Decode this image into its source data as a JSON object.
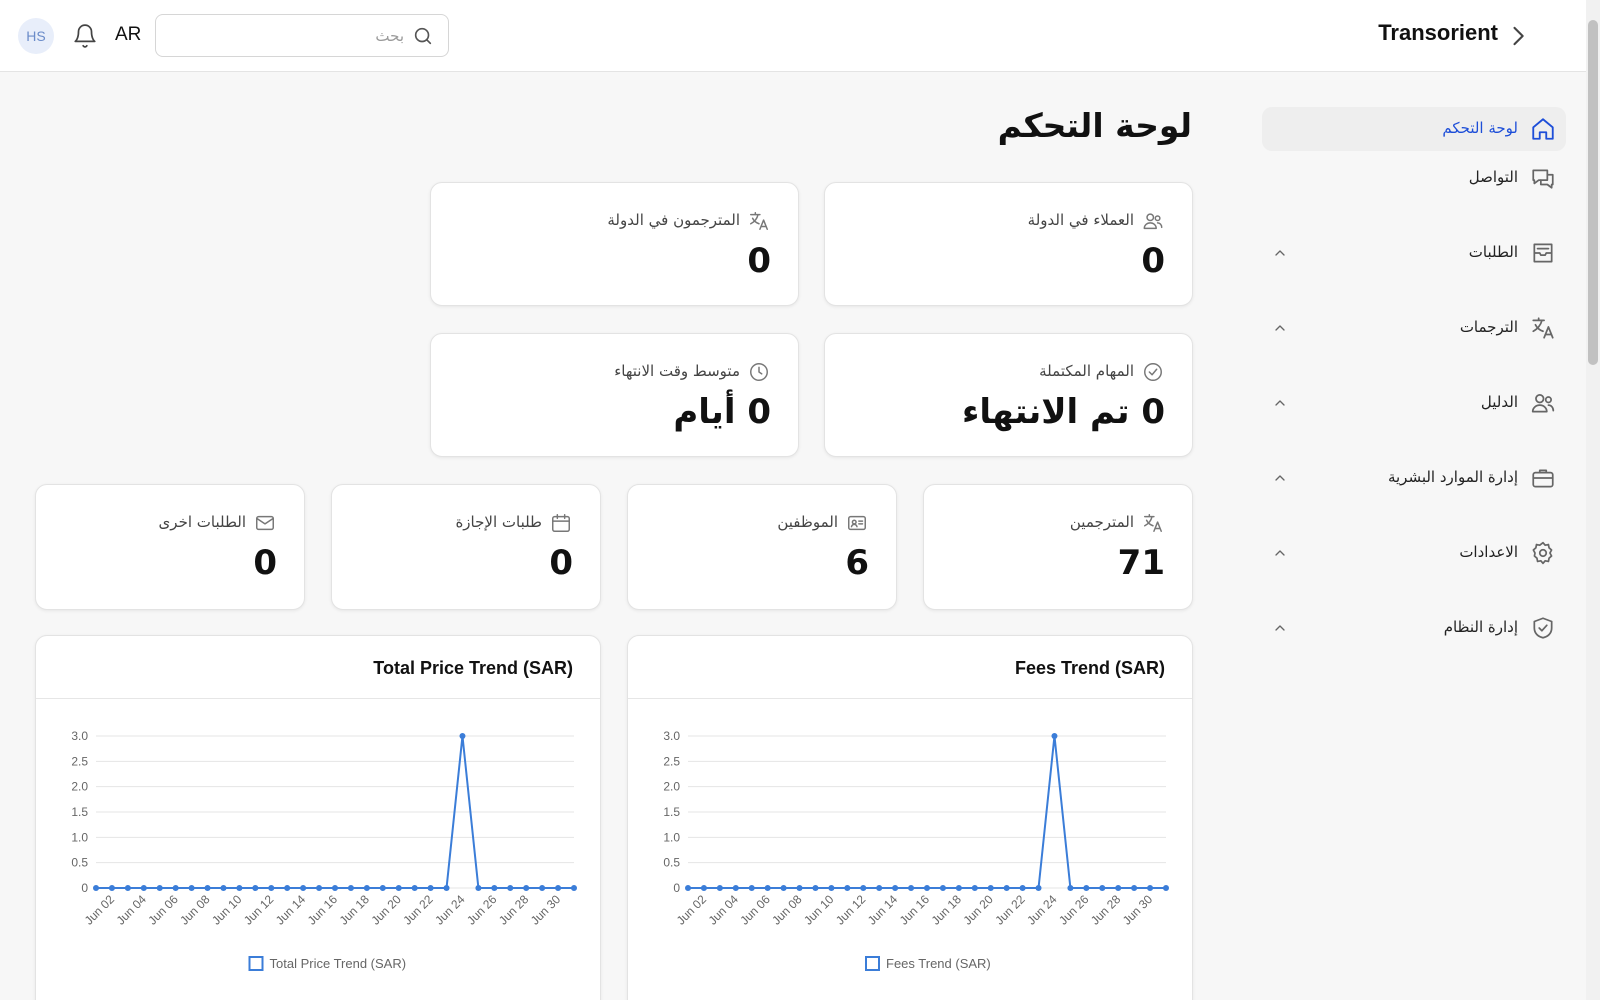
{
  "header": {
    "avatar_initials": "HS",
    "language": "AR",
    "search_placeholder": "بحث",
    "search_value": "",
    "brand": "Transorient"
  },
  "sidebar": {
    "items": [
      {
        "label": "لوحة التحكم",
        "icon": "home-icon",
        "active": true,
        "expandable": false
      },
      {
        "label": "التواصل",
        "icon": "chat-icon",
        "active": false,
        "expandable": false
      },
      {
        "label": "الطلبات",
        "icon": "inbox-icon",
        "active": false,
        "expandable": true
      },
      {
        "label": "الترجمات",
        "icon": "translate-icon",
        "active": false,
        "expandable": true
      },
      {
        "label": "الدليل",
        "icon": "users-icon",
        "active": false,
        "expandable": true
      },
      {
        "label": "إدارة الموارد البشرية",
        "icon": "briefcase-icon",
        "active": false,
        "expandable": true
      },
      {
        "label": "الاعدادات",
        "icon": "gear-icon",
        "active": false,
        "expandable": true
      },
      {
        "label": "إدارة النظام",
        "icon": "shield-check-icon",
        "active": false,
        "expandable": true
      }
    ]
  },
  "main": {
    "title": "لوحة التحكم",
    "stats_top": [
      {
        "label": "العملاء في الدولة",
        "value": "0",
        "icon": "users-icon"
      },
      {
        "label": "المترجمون في الدولة",
        "value": "0",
        "icon": "translate-icon"
      },
      {
        "label": "المهام المكتملة",
        "value": "0 تم الانتهاء",
        "icon": "check-circle-icon"
      },
      {
        "label": "متوسط وقت الانتهاء",
        "value": "0 أيام",
        "icon": "clock-icon"
      }
    ],
    "stats_bottom": [
      {
        "label": "المترجمين",
        "value": "71",
        "icon": "translate-icon"
      },
      {
        "label": "الموظفين",
        "value": "6",
        "icon": "id-card-icon"
      },
      {
        "label": "طلبات الإجازة",
        "value": "0",
        "icon": "calendar-icon"
      },
      {
        "label": "الطلبات اخرى",
        "value": "0",
        "icon": "mail-icon"
      }
    ]
  },
  "colors": {
    "accent": "#1d4ed8",
    "series": "#3b7dd8"
  },
  "chart_data": [
    {
      "type": "line",
      "title": "Fees Trend (SAR)",
      "x": [
        "Jun 01",
        "Jun 02",
        "Jun 03",
        "Jun 04",
        "Jun 05",
        "Jun 06",
        "Jun 07",
        "Jun 08",
        "Jun 09",
        "Jun 10",
        "Jun 11",
        "Jun 12",
        "Jun 13",
        "Jun 14",
        "Jun 15",
        "Jun 16",
        "Jun 17",
        "Jun 18",
        "Jun 19",
        "Jun 20",
        "Jun 21",
        "Jun 22",
        "Jun 23",
        "Jun 24",
        "Jun 25",
        "Jun 26",
        "Jun 27",
        "Jun 28",
        "Jun 29",
        "Jun 30",
        "Jul 01"
      ],
      "tick_labels": [
        "Jun 02",
        "Jun 04",
        "Jun 06",
        "Jun 08",
        "Jun 10",
        "Jun 12",
        "Jun 14",
        "Jun 16",
        "Jun 18",
        "Jun 20",
        "Jun 22",
        "Jun 24",
        "Jun 26",
        "Jun 28",
        "Jun 30"
      ],
      "series": [
        {
          "name": "Fees Trend (SAR)",
          "values": [
            0,
            0,
            0,
            0,
            0,
            0,
            0,
            0,
            0,
            0,
            0,
            0,
            0,
            0,
            0,
            0,
            0,
            0,
            0,
            0,
            0,
            0,
            0,
            3,
            0,
            0,
            0,
            0,
            0,
            0,
            0
          ]
        }
      ],
      "yticks": [
        "0",
        "0.5",
        "1.0",
        "1.5",
        "2.0",
        "2.5",
        "3.0"
      ],
      "ylim": [
        0,
        3
      ],
      "grid": true,
      "legend": "bottom"
    },
    {
      "type": "line",
      "title": "Total Price Trend (SAR)",
      "x": [
        "Jun 01",
        "Jun 02",
        "Jun 03",
        "Jun 04",
        "Jun 05",
        "Jun 06",
        "Jun 07",
        "Jun 08",
        "Jun 09",
        "Jun 10",
        "Jun 11",
        "Jun 12",
        "Jun 13",
        "Jun 14",
        "Jun 15",
        "Jun 16",
        "Jun 17",
        "Jun 18",
        "Jun 19",
        "Jun 20",
        "Jun 21",
        "Jun 22",
        "Jun 23",
        "Jun 24",
        "Jun 25",
        "Jun 26",
        "Jun 27",
        "Jun 28",
        "Jun 29",
        "Jun 30",
        "Jul 01"
      ],
      "tick_labels": [
        "Jun 02",
        "Jun 04",
        "Jun 06",
        "Jun 08",
        "Jun 10",
        "Jun 12",
        "Jun 14",
        "Jun 16",
        "Jun 18",
        "Jun 20",
        "Jun 22",
        "Jun 24",
        "Jun 26",
        "Jun 28",
        "Jun 30"
      ],
      "series": [
        {
          "name": "Total Price Trend (SAR)",
          "values": [
            0,
            0,
            0,
            0,
            0,
            0,
            0,
            0,
            0,
            0,
            0,
            0,
            0,
            0,
            0,
            0,
            0,
            0,
            0,
            0,
            0,
            0,
            0,
            3,
            0,
            0,
            0,
            0,
            0,
            0,
            0
          ]
        }
      ],
      "yticks": [
        "0",
        "0.5",
        "1.0",
        "1.5",
        "2.0",
        "2.5",
        "3.0"
      ],
      "ylim": [
        0,
        3
      ],
      "grid": true,
      "legend": "bottom"
    }
  ]
}
